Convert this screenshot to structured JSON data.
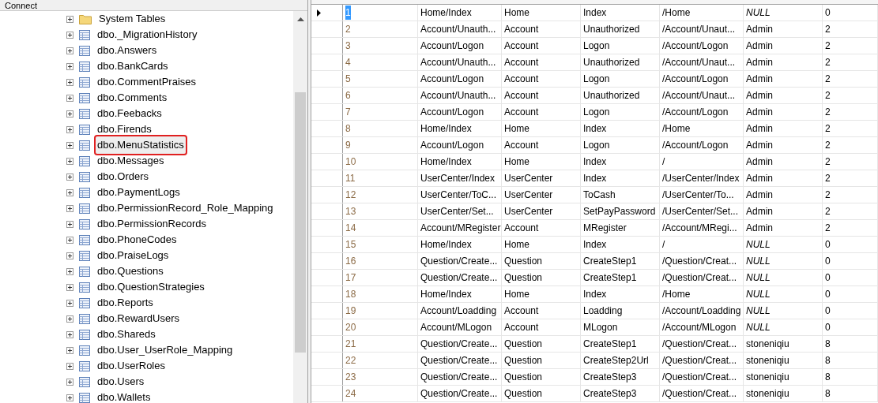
{
  "toolbar": {
    "connect_label": "Connect"
  },
  "tree": {
    "items": [
      {
        "label": "System Tables",
        "kind": "folder",
        "highlighted": false
      },
      {
        "label": "dbo._MigrationHistory",
        "kind": "table",
        "highlighted": false
      },
      {
        "label": "dbo.Answers",
        "kind": "table",
        "highlighted": false
      },
      {
        "label": "dbo.BankCards",
        "kind": "table",
        "highlighted": false
      },
      {
        "label": "dbo.CommentPraises",
        "kind": "table",
        "highlighted": false
      },
      {
        "label": "dbo.Comments",
        "kind": "table",
        "highlighted": false
      },
      {
        "label": "dbo.Feebacks",
        "kind": "table",
        "highlighted": false
      },
      {
        "label": "dbo.Firends",
        "kind": "table",
        "highlighted": false
      },
      {
        "label": "dbo.MenuStatistics",
        "kind": "table",
        "highlighted": true
      },
      {
        "label": "dbo.Messages",
        "kind": "table",
        "highlighted": false
      },
      {
        "label": "dbo.Orders",
        "kind": "table",
        "highlighted": false
      },
      {
        "label": "dbo.PaymentLogs",
        "kind": "table",
        "highlighted": false
      },
      {
        "label": "dbo.PermissionRecord_Role_Mapping",
        "kind": "table",
        "highlighted": false
      },
      {
        "label": "dbo.PermissionRecords",
        "kind": "table",
        "highlighted": false
      },
      {
        "label": "dbo.PhoneCodes",
        "kind": "table",
        "highlighted": false
      },
      {
        "label": "dbo.PraiseLogs",
        "kind": "table",
        "highlighted": false
      },
      {
        "label": "dbo.Questions",
        "kind": "table",
        "highlighted": false
      },
      {
        "label": "dbo.QuestionStrategies",
        "kind": "table",
        "highlighted": false
      },
      {
        "label": "dbo.Reports",
        "kind": "table",
        "highlighted": false
      },
      {
        "label": "dbo.RewardUsers",
        "kind": "table",
        "highlighted": false
      },
      {
        "label": "dbo.Shareds",
        "kind": "table",
        "highlighted": false
      },
      {
        "label": "dbo.User_UserRole_Mapping",
        "kind": "table",
        "highlighted": false
      },
      {
        "label": "dbo.UserRoles",
        "kind": "table",
        "highlighted": false
      },
      {
        "label": "dbo.Users",
        "kind": "table",
        "highlighted": false
      },
      {
        "label": "dbo.Wallets",
        "kind": "table",
        "highlighted": false
      }
    ]
  },
  "grid": {
    "rows": [
      {
        "selected": true,
        "role_null": true,
        "cells": [
          "1",
          "Home/Index",
          "Home",
          "Index",
          "/Home",
          "NULL",
          "0"
        ]
      },
      {
        "selected": false,
        "role_null": false,
        "cells": [
          "2",
          "Account/Unauth...",
          "Account",
          "Unauthorized",
          "/Account/Unaut...",
          "Admin",
          "2"
        ]
      },
      {
        "selected": false,
        "role_null": false,
        "cells": [
          "3",
          "Account/Logon",
          "Account",
          "Logon",
          "/Account/Logon",
          "Admin",
          "2"
        ]
      },
      {
        "selected": false,
        "role_null": false,
        "cells": [
          "4",
          "Account/Unauth...",
          "Account",
          "Unauthorized",
          "/Account/Unaut...",
          "Admin",
          "2"
        ]
      },
      {
        "selected": false,
        "role_null": false,
        "cells": [
          "5",
          "Account/Logon",
          "Account",
          "Logon",
          "/Account/Logon",
          "Admin",
          "2"
        ]
      },
      {
        "selected": false,
        "role_null": false,
        "cells": [
          "6",
          "Account/Unauth...",
          "Account",
          "Unauthorized",
          "/Account/Unaut...",
          "Admin",
          "2"
        ]
      },
      {
        "selected": false,
        "role_null": false,
        "cells": [
          "7",
          "Account/Logon",
          "Account",
          "Logon",
          "/Account/Logon",
          "Admin",
          "2"
        ]
      },
      {
        "selected": false,
        "role_null": false,
        "cells": [
          "8",
          "Home/Index",
          "Home",
          "Index",
          "/Home",
          "Admin",
          "2"
        ]
      },
      {
        "selected": false,
        "role_null": false,
        "cells": [
          "9",
          "Account/Logon",
          "Account",
          "Logon",
          "/Account/Logon",
          "Admin",
          "2"
        ]
      },
      {
        "selected": false,
        "role_null": false,
        "cells": [
          "10",
          "Home/Index",
          "Home",
          "Index",
          "/",
          "Admin",
          "2"
        ]
      },
      {
        "selected": false,
        "role_null": false,
        "cells": [
          "11",
          "UserCenter/Index",
          "UserCenter",
          "Index",
          "/UserCenter/Index",
          "Admin",
          "2"
        ]
      },
      {
        "selected": false,
        "role_null": false,
        "cells": [
          "12",
          "UserCenter/ToC...",
          "UserCenter",
          "ToCash",
          "/UserCenter/To...",
          "Admin",
          "2"
        ]
      },
      {
        "selected": false,
        "role_null": false,
        "cells": [
          "13",
          "UserCenter/Set...",
          "UserCenter",
          "SetPayPassword",
          "/UserCenter/Set...",
          "Admin",
          "2"
        ]
      },
      {
        "selected": false,
        "role_null": false,
        "cells": [
          "14",
          "Account/MRegister",
          "Account",
          "MRegister",
          "/Account/MRegi...",
          "Admin",
          "2"
        ]
      },
      {
        "selected": false,
        "role_null": true,
        "cells": [
          "15",
          "Home/Index",
          "Home",
          "Index",
          "/",
          "NULL",
          "0"
        ]
      },
      {
        "selected": false,
        "role_null": true,
        "cells": [
          "16",
          "Question/Create...",
          "Question",
          "CreateStep1",
          "/Question/Creat...",
          "NULL",
          "0"
        ]
      },
      {
        "selected": false,
        "role_null": true,
        "cells": [
          "17",
          "Question/Create...",
          "Question",
          "CreateStep1",
          "/Question/Creat...",
          "NULL",
          "0"
        ]
      },
      {
        "selected": false,
        "role_null": true,
        "cells": [
          "18",
          "Home/Index",
          "Home",
          "Index",
          "/Home",
          "NULL",
          "0"
        ]
      },
      {
        "selected": false,
        "role_null": true,
        "cells": [
          "19",
          "Account/Loadding",
          "Account",
          "Loadding",
          "/Account/Loadding",
          "NULL",
          "0"
        ]
      },
      {
        "selected": false,
        "role_null": true,
        "cells": [
          "20",
          "Account/MLogon",
          "Account",
          "MLogon",
          "/Account/MLogon",
          "NULL",
          "0"
        ]
      },
      {
        "selected": false,
        "role_null": false,
        "cells": [
          "21",
          "Question/Create...",
          "Question",
          "CreateStep1",
          "/Question/Creat...",
          "stoneniqiu",
          "8"
        ]
      },
      {
        "selected": false,
        "role_null": false,
        "cells": [
          "22",
          "Question/Create...",
          "Question",
          "CreateStep2Url",
          "/Question/Creat...",
          "stoneniqiu",
          "8"
        ]
      },
      {
        "selected": false,
        "role_null": false,
        "cells": [
          "23",
          "Question/Create...",
          "Question",
          "CreateStep3",
          "/Question/Creat...",
          "stoneniqiu",
          "8"
        ]
      },
      {
        "selected": false,
        "role_null": false,
        "cells": [
          "24",
          "Question/Create...",
          "Question",
          "CreateStep3",
          "/Question/Creat...",
          "stoneniqiu",
          "8"
        ]
      }
    ]
  }
}
